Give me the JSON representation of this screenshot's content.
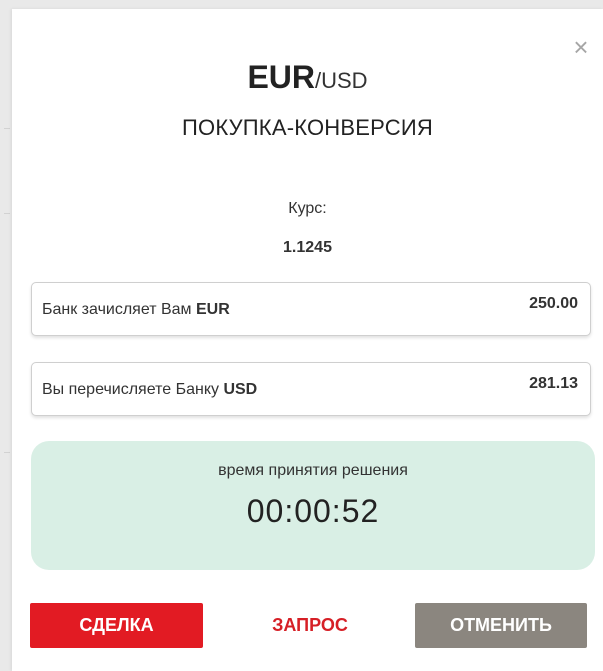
{
  "header": {
    "base_currency": "EUR",
    "quote_currency": "/USD",
    "operation": "ПОКУПКА-КОНВЕРСИЯ",
    "close_icon": "close-icon"
  },
  "rate": {
    "label": "Курс:",
    "value": "1.1245"
  },
  "receive": {
    "label": "Банк зачисляет Вам ",
    "currency": "EUR",
    "amount": "250.00"
  },
  "pay": {
    "label": "Вы перечисляете Банку ",
    "currency": "USD",
    "amount": "281.13"
  },
  "timer": {
    "label": "время принятия решения",
    "value": "00:00:52"
  },
  "actions": {
    "deal": "СДЕЛКА",
    "request": "ЗАПРОС",
    "cancel": "ОТМЕНИТЬ"
  },
  "colors": {
    "deal_bg": "#e21b23",
    "request_text": "#d61f26",
    "cancel_bg": "#8b867f",
    "timer_bg": "#d9efe5"
  }
}
